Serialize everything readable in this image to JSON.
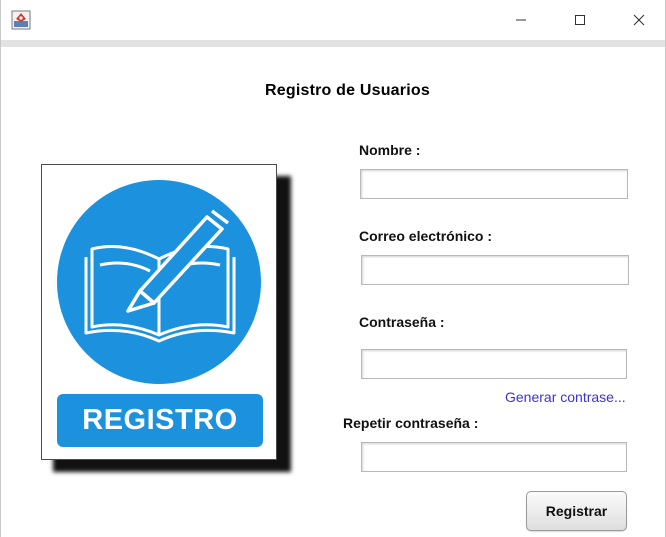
{
  "window": {
    "icons": {
      "app": "java-app-icon",
      "minimize": "minimize-icon",
      "maximize": "maximize-icon",
      "close": "close-icon"
    }
  },
  "form": {
    "title": "Registro de Usuarios",
    "name_label": "Nombre :",
    "name_value": "",
    "email_label": "Correo electrónico :",
    "email_value": "",
    "password_label": "Contraseña :",
    "password_value": "",
    "generate_link": "Generar contrase...",
    "repeat_label": "Repetir contraseña :",
    "repeat_value": "",
    "submit_label": "Registrar"
  },
  "image": {
    "badge_text": "REGISTRO",
    "icon": "book-pen-icon"
  },
  "colors": {
    "brand_blue": "#1c92df",
    "link": "#3a34d8"
  }
}
